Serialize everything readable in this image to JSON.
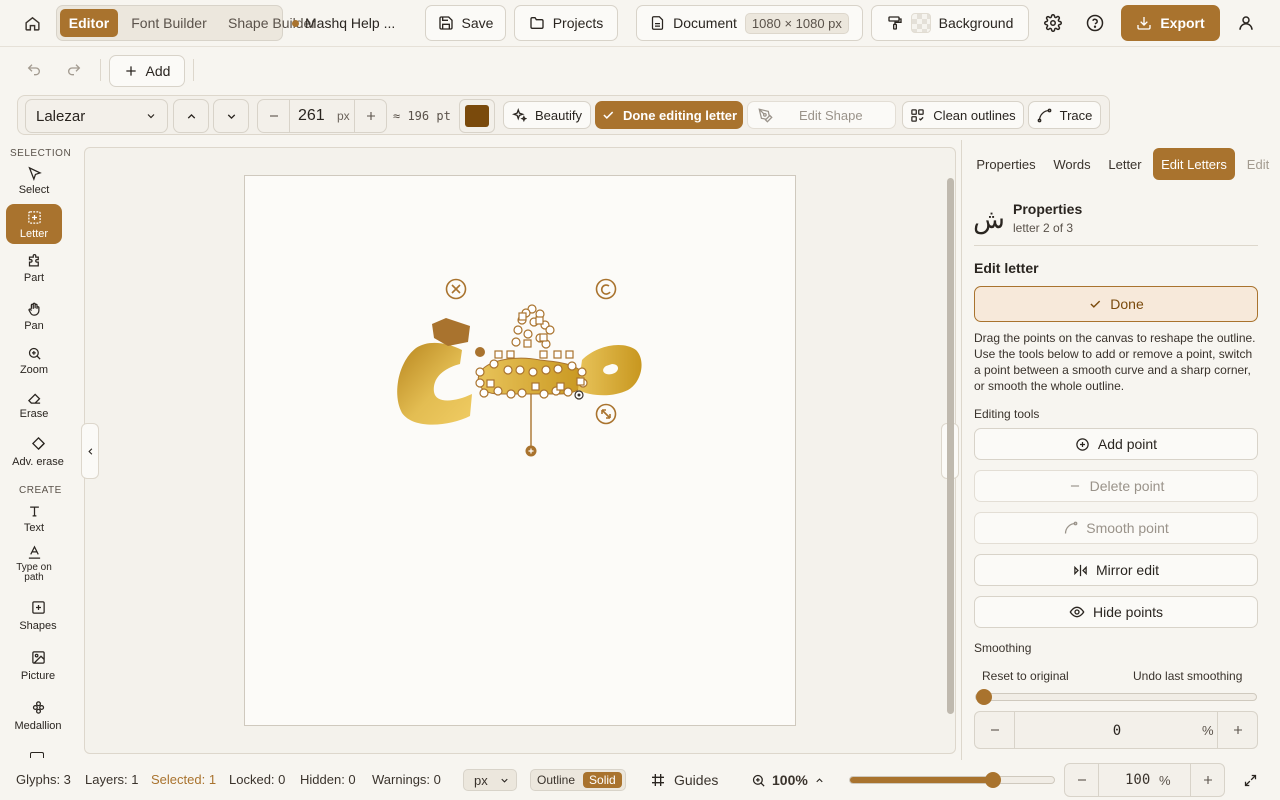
{
  "topbar": {
    "home_icon": "home-icon",
    "tabs": [
      {
        "label": "Editor",
        "active": true
      },
      {
        "label": "Font Builder",
        "active": false
      },
      {
        "label": "Shape Builder",
        "active": false
      }
    ],
    "help_link": "Mashq Help ...",
    "save_label": "Save",
    "projects_label": "Projects",
    "document_label": "Document",
    "document_size": "1080 × 1080 px",
    "background_label": "Background",
    "export_label": "Export"
  },
  "toolbar1": {
    "add_label": "Add"
  },
  "toolbar2": {
    "font_name": "Lalezar",
    "font_size": "261",
    "font_unit": "px",
    "pt_equivalent": "≈ 196 pt",
    "color": "#7a4a0c",
    "beautify_label": "Beautify",
    "done_editing_label": "Done editing letter",
    "edit_shape_label": "Edit Shape",
    "clean_outlines_label": "Clean outlines",
    "trace_label": "Trace"
  },
  "sidebar": {
    "section_selection": "SELECTION",
    "section_create": "CREATE",
    "tools": [
      {
        "label": "Select",
        "icon": "cursor-icon"
      },
      {
        "label": "Letter",
        "icon": "letter-select-icon",
        "active": true
      },
      {
        "label": "Part",
        "icon": "puzzle-icon"
      },
      {
        "label": "Pan",
        "icon": "hand-icon"
      },
      {
        "label": "Zoom",
        "icon": "zoom-icon"
      },
      {
        "label": "Erase",
        "icon": "eraser-icon"
      },
      {
        "label": "Adv. erase",
        "icon": "advanced-eraser-icon"
      },
      {
        "label": "Text",
        "icon": "text-icon"
      },
      {
        "label": "Type on path",
        "icon": "type-on-path-icon"
      },
      {
        "label": "Shapes",
        "icon": "shapes-icon"
      },
      {
        "label": "Picture",
        "icon": "picture-icon"
      },
      {
        "label": "Medallion",
        "icon": "medallion-icon"
      }
    ]
  },
  "panel": {
    "tabs": [
      {
        "label": "Properties"
      },
      {
        "label": "Words"
      },
      {
        "label": "Letter"
      },
      {
        "label": "Edit Letters",
        "active": true
      },
      {
        "label": "Edit"
      }
    ],
    "glyph": "ش",
    "title": "Properties",
    "subtitle": "letter 2 of 3",
    "edit_letter_heading": "Edit letter",
    "done_label": "Done",
    "description": "Drag the points on the canvas to reshape the outline. Use the tools below to add or remove a point, switch a point between a smooth curve and a sharp corner, or smooth the whole outline.",
    "editing_tools_heading": "Editing tools",
    "add_point": "Add point",
    "delete_point": "Delete point",
    "smooth_point": "Smooth point",
    "mirror_edit": "Mirror edit",
    "hide_points": "Hide points",
    "smoothing_heading": "Smoothing",
    "reset_original": "Reset to original",
    "undo_smoothing": "Undo last smoothing",
    "smoothing_value": "0",
    "smoothing_unit": "%",
    "smoothing_level": 0
  },
  "statusbar": {
    "glyphs": "Glyphs: 3",
    "layers": "Layers: 1",
    "selected": "Selected: 1",
    "locked": "Locked: 0",
    "hidden": "Hidden: 0",
    "warnings": "Warnings: 0",
    "unit": "px",
    "outline_label": "Outline",
    "solid_label": "Solid",
    "guides_label": "Guides",
    "zoom_display": "100%",
    "zoom_level": 0.7,
    "zoom_value": "100",
    "zoom_unit": "%"
  },
  "colors": {
    "accent": "#a9732e",
    "gold_light": "#e8c35a",
    "gold_dark": "#b8861f"
  }
}
